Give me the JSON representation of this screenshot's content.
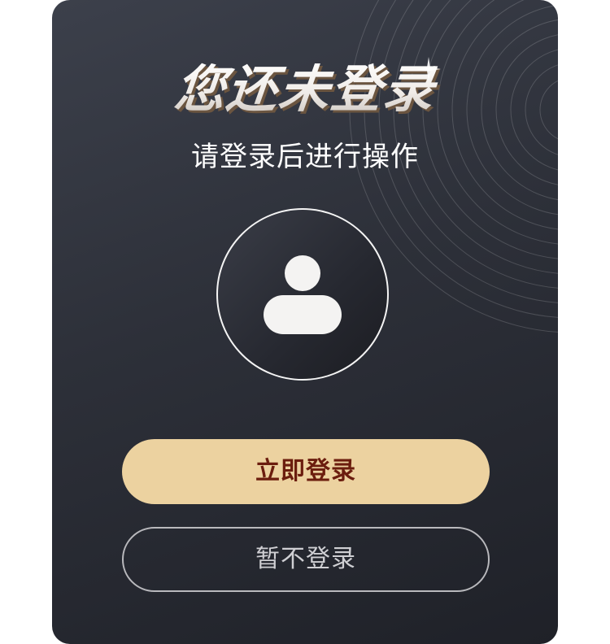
{
  "dialog": {
    "title": "您还未登录",
    "subtitle": "请登录后进行操作",
    "avatar_icon": "user-avatar-icon",
    "login_button_label": "立即登录",
    "skip_button_label": "暂不登录"
  },
  "colors": {
    "card_background": "#2d3039",
    "primary_button": "#ecd2a0",
    "primary_button_text": "#6b1d0e",
    "secondary_border": "#b9b9bd",
    "secondary_text": "#cfcfd3"
  }
}
